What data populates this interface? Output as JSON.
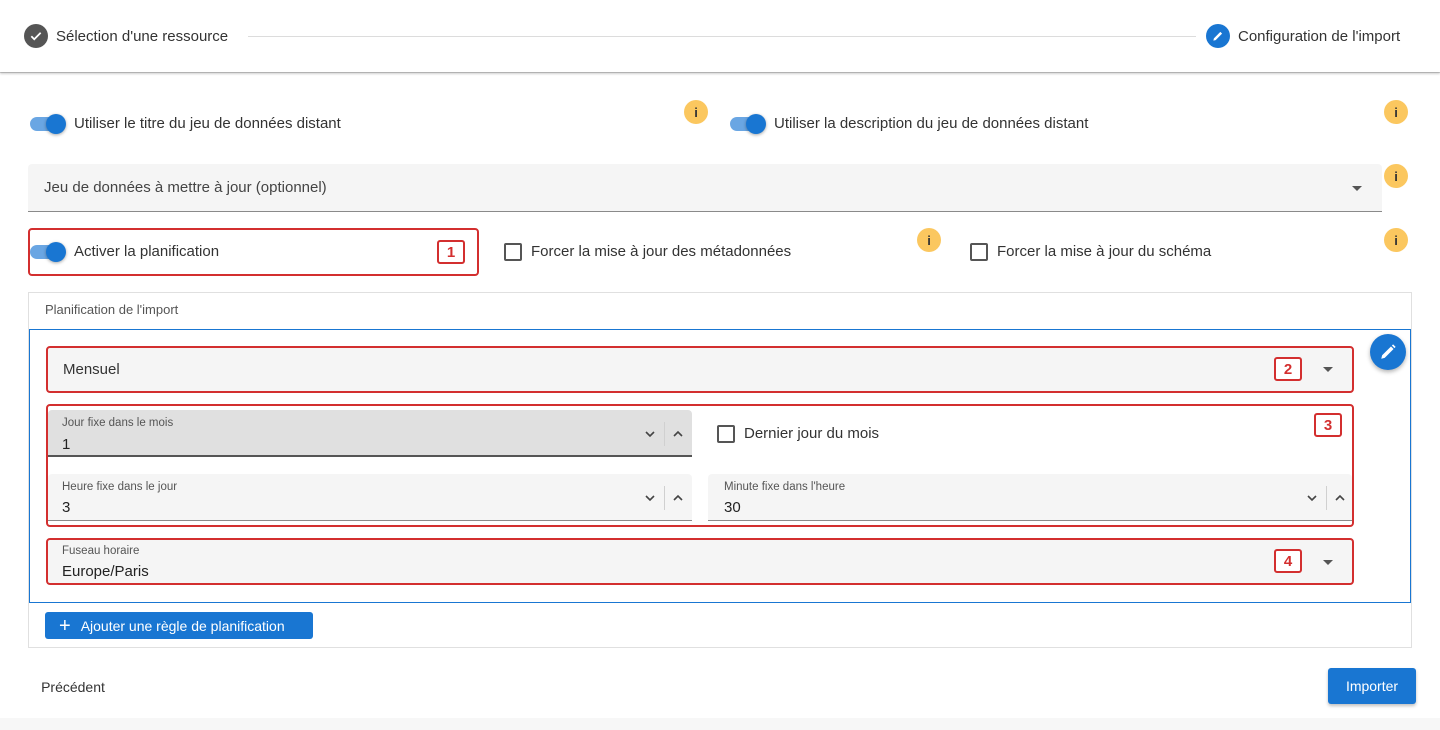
{
  "stepper": {
    "step1_label": "Sélection d'une ressource",
    "step2_label": "Configuration de l'import"
  },
  "toggles": {
    "use_title_label": "Utiliser le titre du jeu de données distant",
    "use_title_on": true,
    "use_description_label": "Utiliser la description du jeu de données distant",
    "use_description_on": true,
    "activate_schedule_label": "Activer la planification",
    "activate_schedule_on": true
  },
  "info_glyph": "i",
  "dataset_select": {
    "placeholder": "Jeu de données à mettre à jour (optionnel)"
  },
  "checkboxes": {
    "force_metadata_label": "Forcer la mise à jour des métadonnées",
    "force_metadata_checked": false,
    "force_schema_label": "Forcer la mise à jour du schéma",
    "force_schema_checked": false,
    "last_day_label": "Dernier jour du mois",
    "last_day_checked": false
  },
  "schedule": {
    "card_title": "Planification de l'import",
    "frequency_value": "Mensuel",
    "day_label": "Jour fixe dans le mois",
    "day_value": "1",
    "hour_label": "Heure fixe dans le jour",
    "hour_value": "3",
    "minute_label": "Minute fixe dans l'heure",
    "minute_value": "30",
    "timezone_label": "Fuseau horaire",
    "timezone_value": "Europe/Paris",
    "add_rule_label": "Ajouter une règle de planification"
  },
  "badges": [
    "1",
    "2",
    "3",
    "4"
  ],
  "footer": {
    "previous_label": "Précédent",
    "import_label": "Importer"
  },
  "colors": {
    "primary": "#1976d2",
    "annotation_red": "#d32f2f",
    "info_yellow": "#fbc75f"
  }
}
